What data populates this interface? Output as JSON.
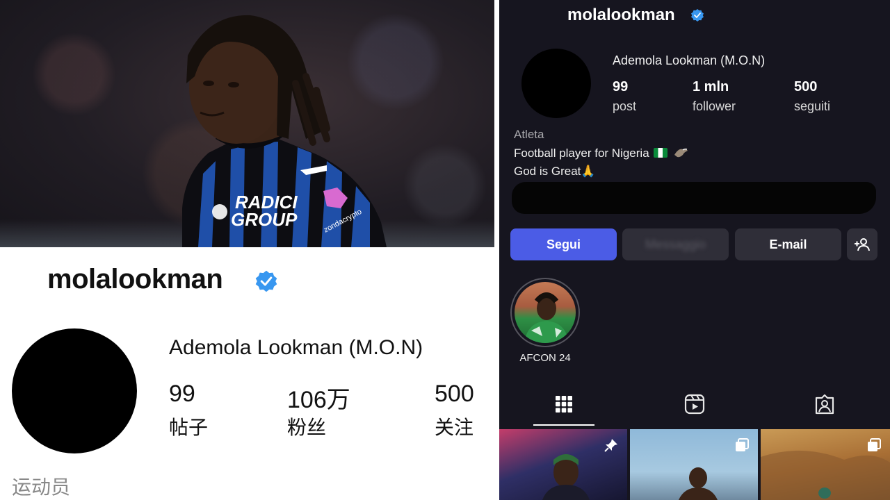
{
  "left_panel": {
    "handle": "molalookman",
    "display_name": "Ademola Lookman (M.O.N)",
    "stats": [
      {
        "value": "99",
        "label": "帖子"
      },
      {
        "value": "106万",
        "label": "粉丝"
      },
      {
        "value": "500",
        "label": "关注"
      }
    ],
    "category": "运动员",
    "photo": {
      "jersey_sponsor_line1": "RADICI",
      "jersey_sponsor_line2": "GROUP",
      "sleeve_text": "zondacrypto",
      "colors": {
        "blue": "#1f4fa8",
        "black": "#0d0d12"
      }
    }
  },
  "right_panel": {
    "handle": "molalookman",
    "display_name": "Ademola Lookman (M.O.N)",
    "stats": [
      {
        "value": "99",
        "label": "post"
      },
      {
        "value": "1 mln",
        "label": "follower"
      },
      {
        "value": "500",
        "label": "seguiti"
      }
    ],
    "category": "Atleta",
    "bio_line1": "Football player for Nigeria",
    "bio_line2": "God is Great🙏",
    "buttons": {
      "follow": "Segui",
      "message_blurred": "Messaggio",
      "email": "E-mail",
      "add_user_icon": "add-person-icon"
    },
    "highlight_label": "AFCON 24",
    "tabs": [
      "grid-icon",
      "reels-icon",
      "tagged-icon"
    ],
    "colors": {
      "background": "#16151f",
      "follow_button": "#4b5ce6",
      "button": "#2f2e38",
      "verified": "#3897f0"
    }
  }
}
